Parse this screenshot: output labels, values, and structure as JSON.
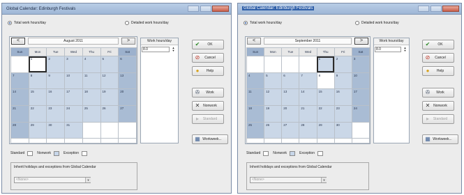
{
  "dialogs": [
    {
      "title": "Global Calendar: Edinburgh Festivals",
      "radio_total": "Total work hours/day",
      "radio_detailed": "Detailed work hours/day",
      "prev_label": "<",
      "next_label": ">",
      "month": "August 2011",
      "days_header": [
        "Sun",
        "Mon",
        "Tue",
        "Wed",
        "Thu",
        "Fri",
        "Sat"
      ],
      "weeks": [
        [
          "",
          "1",
          "2",
          "3",
          "4",
          "5",
          "6"
        ],
        [
          "7",
          "8",
          "9",
          "10",
          "11",
          "12",
          "13"
        ],
        [
          "14",
          "15",
          "16",
          "17",
          "18",
          "19",
          "20"
        ],
        [
          "21",
          "22",
          "23",
          "24",
          "25",
          "26",
          "27"
        ],
        [
          "28",
          "29",
          "30",
          "31",
          "",
          "",
          ""
        ],
        [
          "",
          "",
          "",
          "",
          "",
          "",
          ""
        ]
      ],
      "work_hours_label": "Work hours/day",
      "work_hours_value": "8.0",
      "buttons": {
        "ok": "OK",
        "cancel": "Cancel",
        "help": "Help",
        "work": "Work",
        "nonwork": "Nonwork",
        "standard": "Standard",
        "workweek": "Workweek..."
      },
      "legend": {
        "standard": "Standard",
        "nonwork": "Nonwork",
        "exception": "Exception"
      },
      "import_label": "Inherit holidays and exceptions from Global Calendar",
      "import_value": "<None>"
    },
    {
      "title": "Global Calendar: Edinburgh Festivals",
      "radio_total": "Total work hours/day",
      "radio_detailed": "Detailed work hours/day",
      "prev_label": "<",
      "next_label": ">",
      "month": "September 2011",
      "days_header": [
        "Sun",
        "Mon",
        "Tue",
        "Wed",
        "Thu",
        "Fri",
        "Sat"
      ],
      "weeks": [
        [
          "",
          "",
          "",
          "",
          "1",
          "2",
          "3"
        ],
        [
          "4",
          "5",
          "6",
          "7",
          "8",
          "9",
          "10"
        ],
        [
          "11",
          "12",
          "13",
          "14",
          "15",
          "16",
          "17"
        ],
        [
          "18",
          "19",
          "20",
          "21",
          "22",
          "23",
          "24"
        ],
        [
          "25",
          "26",
          "27",
          "28",
          "29",
          "30",
          ""
        ],
        [
          "",
          "",
          "",
          "",
          "",
          "",
          ""
        ]
      ],
      "work_hours_label": "Work hours/day",
      "work_hours_value": "8.0",
      "buttons": {
        "ok": "OK",
        "cancel": "Cancel",
        "help": "Help",
        "work": "Work",
        "nonwork": "Nonwork",
        "standard": "Standard",
        "workweek": "Workweek..."
      },
      "legend": {
        "standard": "Standard",
        "nonwork": "Nonwork",
        "exception": "Exception"
      },
      "import_label": "Inherit holidays and exceptions from Global Calendar",
      "import_value": "<None>"
    }
  ],
  "icons": {
    "ok": "check-icon",
    "cancel": "cancel-icon",
    "help": "help-icon",
    "work": "work-icon",
    "nonwork": "nonwork-x-icon",
    "standard": "standard-icon",
    "workweek": "calendar-icon"
  },
  "colors": {
    "weekend_cell": "#a9bcd4",
    "workday_cell": "#cad7e7",
    "title_bar": "#9fb7d6",
    "ok_icon": "#2f8a2a",
    "cancel_icon": "#c0392b",
    "help_icon": "#d6a21e"
  }
}
